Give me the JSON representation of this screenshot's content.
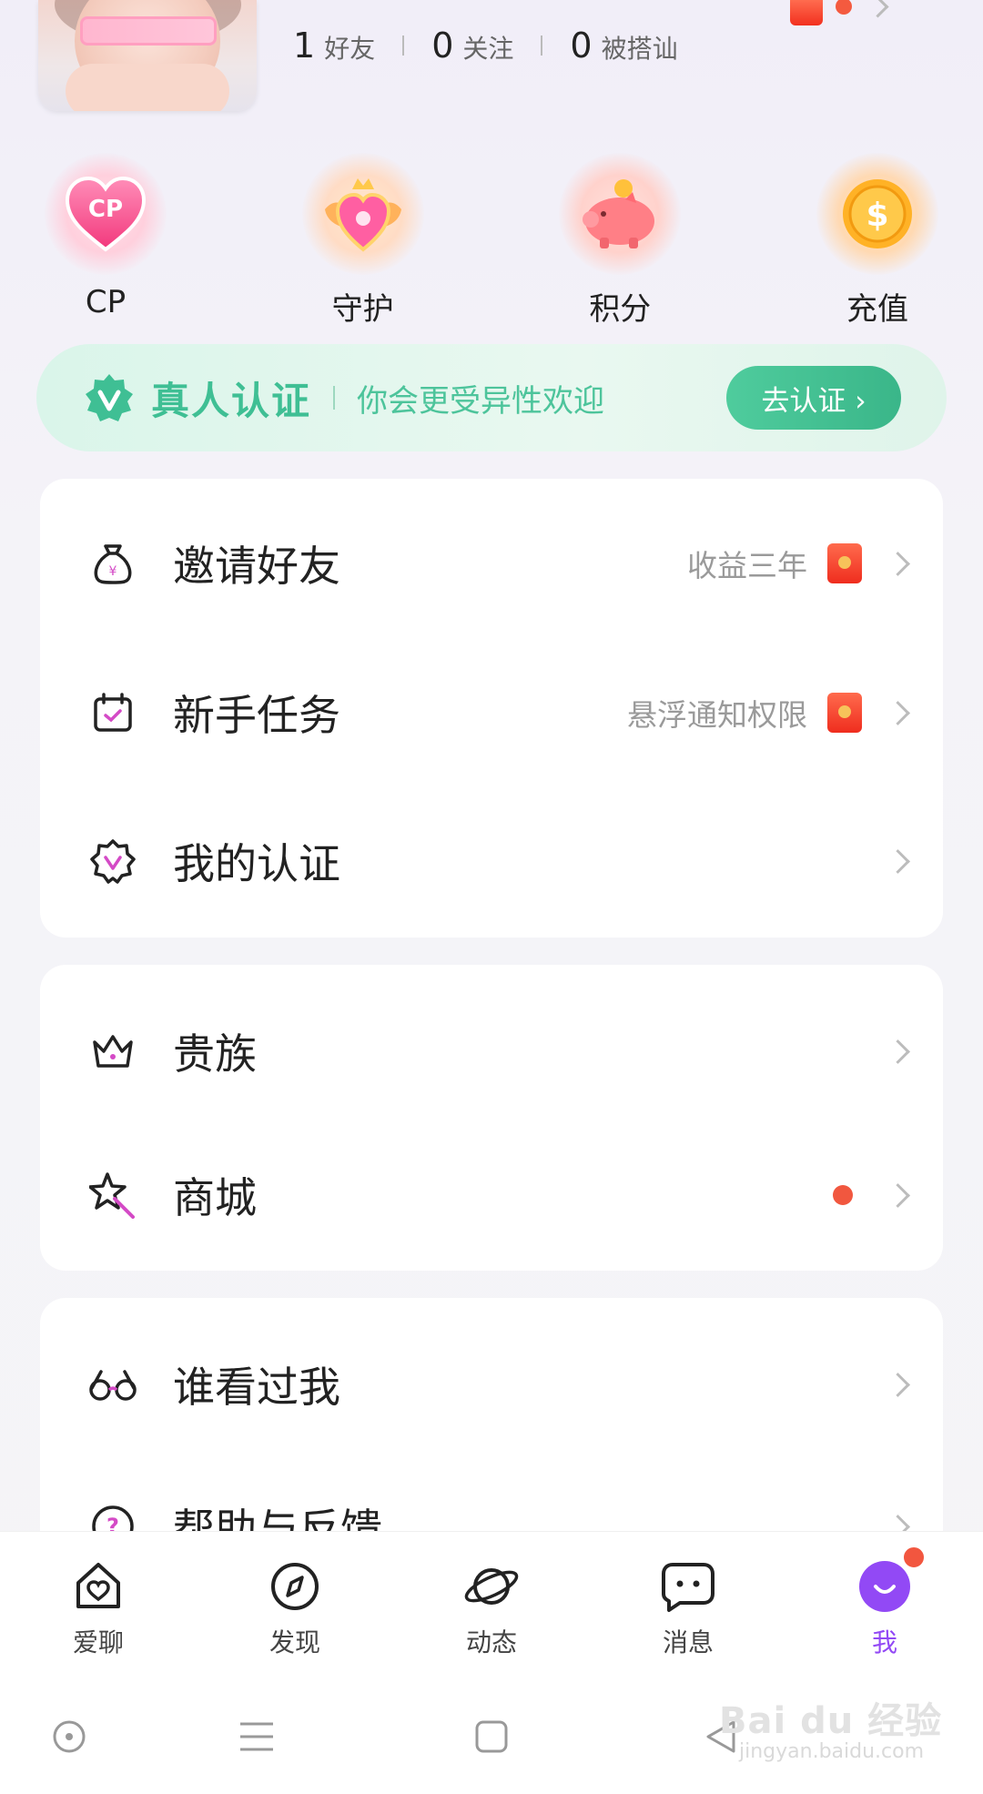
{
  "profile": {
    "stats": [
      {
        "num": "1",
        "label": "好友"
      },
      {
        "num": "0",
        "label": "关注"
      },
      {
        "num": "0",
        "label": "被搭讪"
      }
    ]
  },
  "shortcuts": [
    {
      "label": "CP",
      "icon": "cp-heart-icon",
      "badge": "CP"
    },
    {
      "label": "守护",
      "icon": "guard-shield-icon"
    },
    {
      "label": "积分",
      "icon": "piggy-bank-icon"
    },
    {
      "label": "充值",
      "icon": "coin-icon",
      "badge": "$"
    }
  ],
  "verify_banner": {
    "title": "真人认证",
    "subtitle": "你会更受异性欢迎",
    "button": "去认证 ›"
  },
  "menu_group_1": [
    {
      "label": "邀请好友",
      "hint": "收益三年",
      "icon": "money-bag-icon",
      "red_packet": true
    },
    {
      "label": "新手任务",
      "hint": "悬浮通知权限",
      "icon": "calendar-check-icon",
      "red_packet": true
    },
    {
      "label": "我的认证",
      "hint": "",
      "icon": "verified-badge-icon",
      "red_packet": false
    }
  ],
  "menu_group_2": [
    {
      "label": "贵族",
      "icon": "crown-icon"
    },
    {
      "label": "商城",
      "icon": "magic-wand-icon",
      "dot": true
    }
  ],
  "menu_group_3": [
    {
      "label": "谁看过我",
      "icon": "glasses-icon"
    },
    {
      "label": "帮助与反馈",
      "icon": "help-icon"
    }
  ],
  "tabbar": [
    {
      "label": "爱聊",
      "icon": "home-heart-icon"
    },
    {
      "label": "发现",
      "icon": "compass-icon"
    },
    {
      "label": "动态",
      "icon": "planet-icon"
    },
    {
      "label": "消息",
      "icon": "chat-bubble-icon"
    },
    {
      "label": "我",
      "icon": "me-face-icon",
      "active": true
    }
  ],
  "watermark": {
    "line1": "Bai du 经验",
    "line2": "jingyan.baidu.com"
  },
  "colors": {
    "accent": "#9249f5",
    "verify_green": "#3fbf94",
    "red": "#f1573f"
  }
}
